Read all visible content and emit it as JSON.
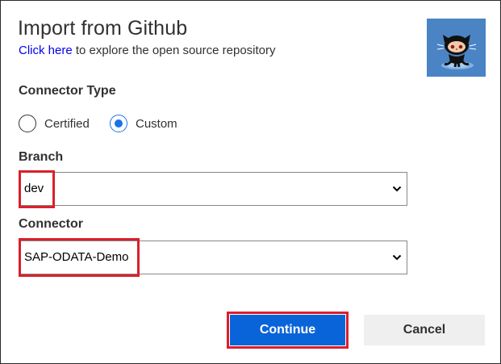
{
  "dialog": {
    "title": "Import from Github",
    "link_text": "Click here",
    "subtitle_rest": " to explore the open source repository"
  },
  "logo": {
    "icon": "github-octocat-icon",
    "bg_color": "#4a84c4"
  },
  "connector_type": {
    "label": "Connector Type",
    "options": [
      {
        "label": "Certified",
        "checked": false
      },
      {
        "label": "Custom",
        "checked": true
      }
    ]
  },
  "branch": {
    "label": "Branch",
    "value": "dev"
  },
  "connector": {
    "label": "Connector",
    "value": "SAP-ODATA-Demo"
  },
  "buttons": {
    "continue": "Continue",
    "cancel": "Cancel"
  },
  "colors": {
    "primary": "#0a64d9",
    "highlight": "#d9202c",
    "radio_accent": "#1a73e8"
  }
}
